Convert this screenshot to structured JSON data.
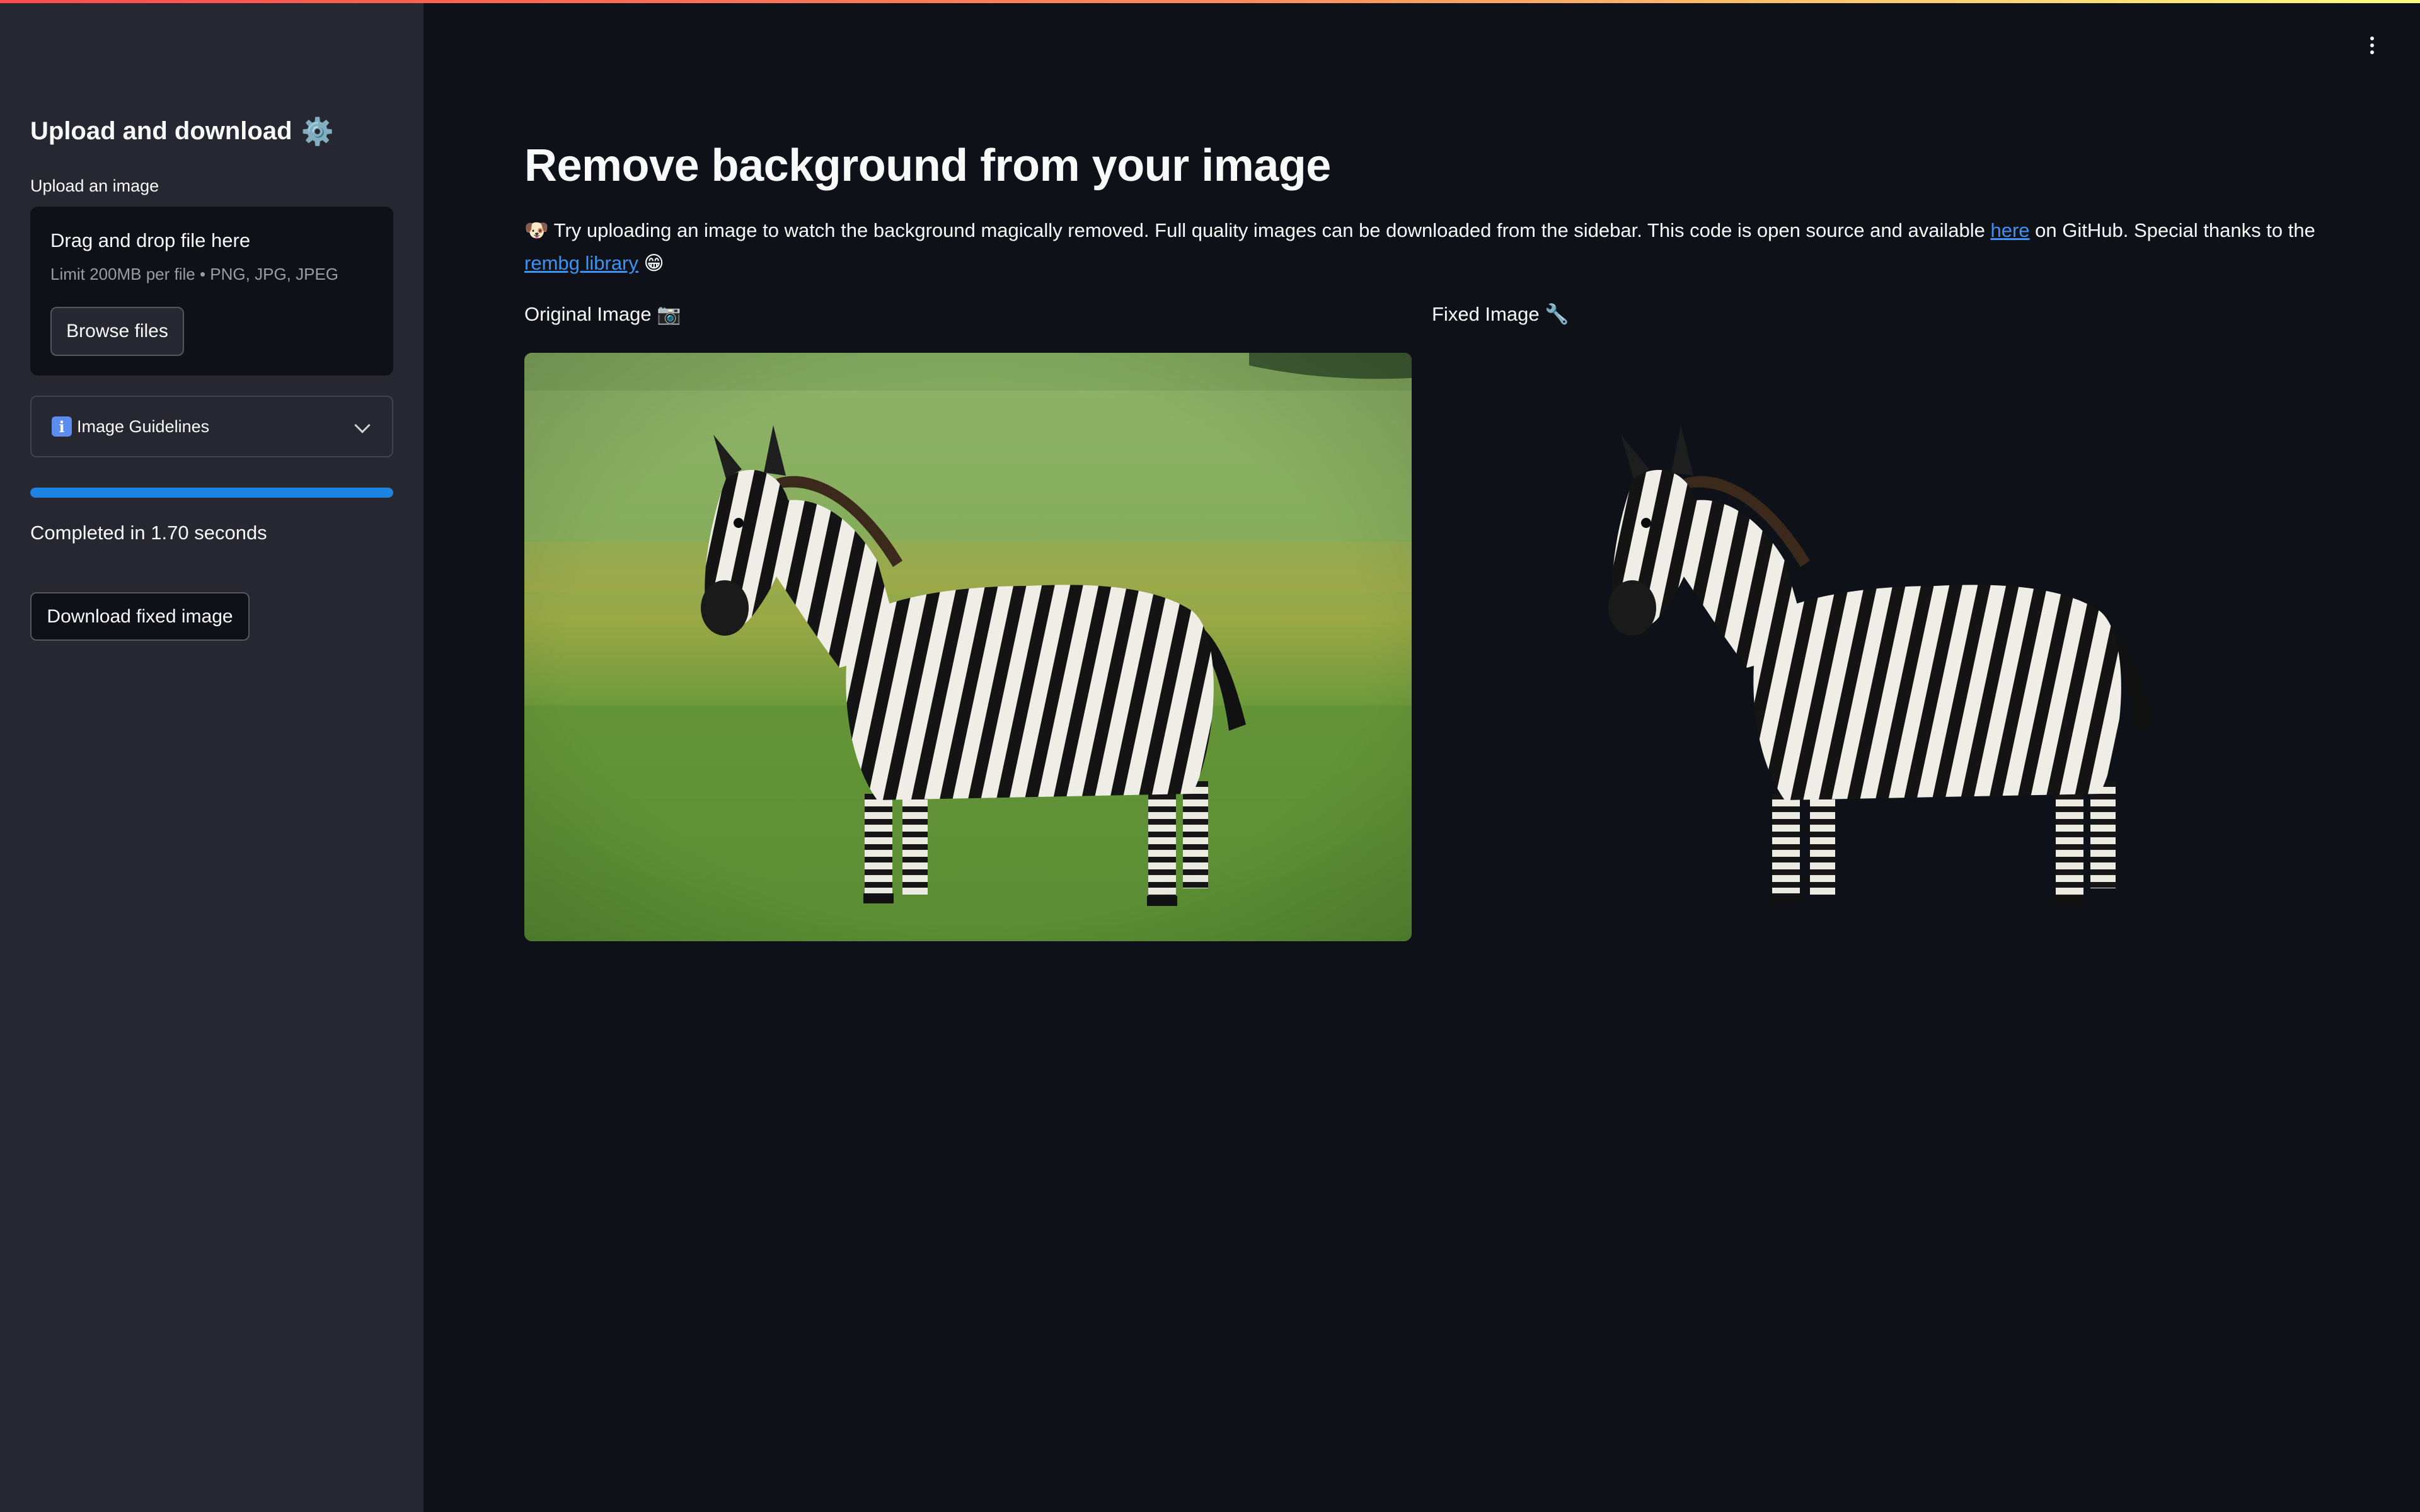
{
  "sidebar": {
    "heading": "Upload and download",
    "heading_icon": "⚙️",
    "upload_label": "Upload an image",
    "dropzone": {
      "title": "Drag and drop file here",
      "limit": "Limit 200MB per file • PNG, JPG, JPEG",
      "browse_label": "Browse files"
    },
    "expander": {
      "icon": "i",
      "label": "Image Guidelines"
    },
    "progress": 1.0,
    "status": "Completed in 1.70 seconds",
    "download_label": "Download fixed image"
  },
  "main": {
    "title": "Remove background from your image",
    "intro": {
      "emoji_start": "🐶",
      "text_before_link": " Try uploading an image to watch the background magically removed. Full quality images can be downloaded from the sidebar. This code is open source and available ",
      "link1": "here",
      "text_middle": " on GitHub. Special thanks to the ",
      "link2": "rembg library",
      "emoji_end": "😁"
    },
    "original_label": "Original Image 📷",
    "fixed_label": "Fixed Image 🔧"
  },
  "colors": {
    "background": "#0e1117",
    "sidebar": "#262730",
    "accent": "#1c83e1",
    "link": "#3b94f5"
  }
}
